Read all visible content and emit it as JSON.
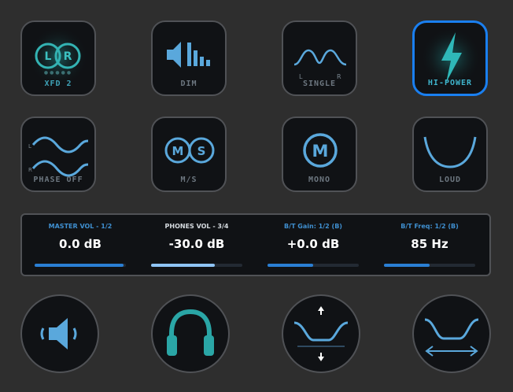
{
  "colors": {
    "accent": "#1a7ff0",
    "icon_blue": "#5aa8dc",
    "teal": "#2aa6a6"
  },
  "buttons_row1": [
    {
      "label": "XFD 2",
      "icon": "lr-crossfeed-icon",
      "dots": "●●●●●"
    },
    {
      "label": "DIM",
      "icon": "speaker-dim-icon"
    },
    {
      "label": "SINGLE",
      "icon": "single-curve-icon",
      "left": "L",
      "right": "R"
    },
    {
      "label": "HI-POWER",
      "icon": "lightning-bolt-icon"
    }
  ],
  "buttons_row2": [
    {
      "label": "PHASE OFF",
      "icon": "phase-waves-icon",
      "left": "L",
      "right": "R"
    },
    {
      "label": "M/S",
      "icon": "mid-side-icon",
      "m": "M",
      "s": "S"
    },
    {
      "label": "MONO",
      "icon": "mono-icon",
      "m": "M"
    },
    {
      "label": "LOUD",
      "icon": "loudness-curve-icon"
    }
  ],
  "xfd_letters": {
    "l": "L",
    "r": "R"
  },
  "controls": [
    {
      "title": "MASTER VOL - 1/2",
      "value": "0.0 dB",
      "level": 0.97
    },
    {
      "title": "PHONES VOL - 3/4",
      "value": "-30.0 dB",
      "level": 0.7
    },
    {
      "title": "B/T Gain: 1/2 (B)",
      "value": "+0.0 dB",
      "level": 0.5
    },
    {
      "title": "B/T Freq: 1/2 (B)",
      "value": "85 Hz",
      "level": 0.5
    }
  ],
  "dials": [
    {
      "icon": "speaker-volume-icon"
    },
    {
      "icon": "headphones-icon"
    },
    {
      "icon": "bass-treble-gain-icon"
    },
    {
      "icon": "bass-treble-freq-icon"
    }
  ]
}
